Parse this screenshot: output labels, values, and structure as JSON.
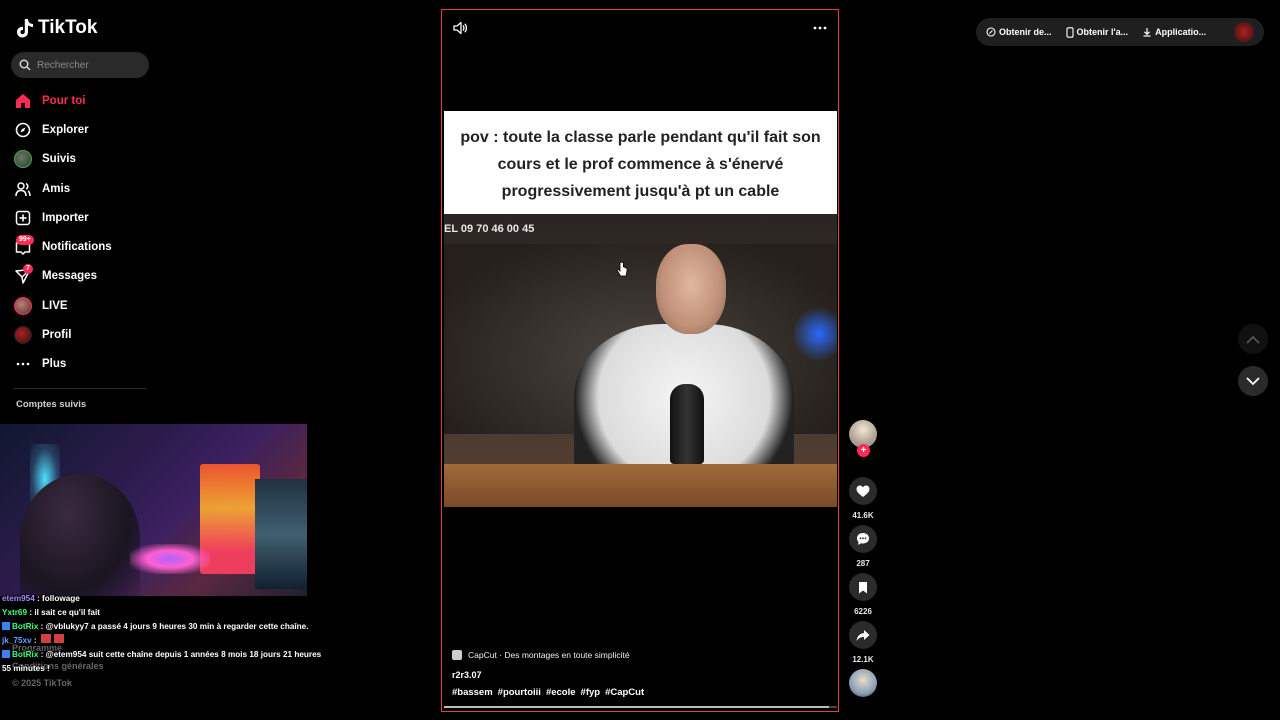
{
  "app": {
    "name": "TikTok"
  },
  "search": {
    "placeholder": "Rechercher"
  },
  "sidebar": {
    "items": [
      {
        "label": "Pour toi",
        "icon": "home-icon"
      },
      {
        "label": "Explorer",
        "icon": "compass-icon"
      },
      {
        "label": "Suivis",
        "icon": "following-avatar-icon"
      },
      {
        "label": "Amis",
        "icon": "friends-icon"
      },
      {
        "label": "Importer",
        "icon": "upload-icon"
      },
      {
        "label": "Notifications",
        "icon": "inbox-icon",
        "badge": "99+"
      },
      {
        "label": "Messages",
        "icon": "send-icon",
        "badge": "7"
      },
      {
        "label": "LIVE",
        "icon": "live-icon"
      },
      {
        "label": "Profil",
        "icon": "profile-avatar-icon"
      },
      {
        "label": "Plus",
        "icon": "more-icon"
      }
    ],
    "section_title": "Comptes suivis",
    "ghost_lines": [
      "Programme",
      "Conditions générales",
      "© 2025 TikTok"
    ]
  },
  "chat": [
    {
      "user": "etem954",
      "message": " : followage",
      "user_color": "purple"
    },
    {
      "user": "Yxtr69",
      "message": " : il sait ce qu'il fait",
      "user_color": "green"
    },
    {
      "user": "BotRix",
      "message": " : @vblukyy7 a passé 4 jours 9 heures 30 min à regarder cette chaîne.",
      "user_color": "green",
      "badge": true
    },
    {
      "user": "jk_75xv",
      "message": " : ",
      "user_color": "blue"
    },
    {
      "user": "BotRix",
      "message": " : @etem954 suit cette chaîne depuis 1 années 8 mois 18 jours 21 heures 55 minutes !",
      "user_color": "green",
      "badge": true
    }
  ],
  "video": {
    "caption": "pov : toute la classe parle pendant qu'il fait son cours et le prof commence à s'énervé progressivement jusqu'à pt un cable",
    "phone_overlay": "EL  09 70 46 00 45",
    "capcut_label": "CapCut · Des montages en toute simplicité",
    "author": "r2r3.07",
    "hashtags": [
      "#bassem",
      "#pourtoiii",
      "#ecole",
      "#fyp",
      "#CapCut"
    ],
    "progress": 0.98
  },
  "actions": {
    "likes": "41.6K",
    "comments": "287",
    "saves": "6226",
    "shares": "12.1K"
  },
  "topbar": {
    "items": [
      {
        "label": "Obtenir de...",
        "icon": "coin-icon"
      },
      {
        "label": "Obtenir l'a...",
        "icon": "phone-icon"
      },
      {
        "label": "Applicatio...",
        "icon": "download-icon"
      }
    ]
  },
  "colors": {
    "accent": "#fe2c55",
    "video_border": "#e84040",
    "background": "#000000"
  }
}
